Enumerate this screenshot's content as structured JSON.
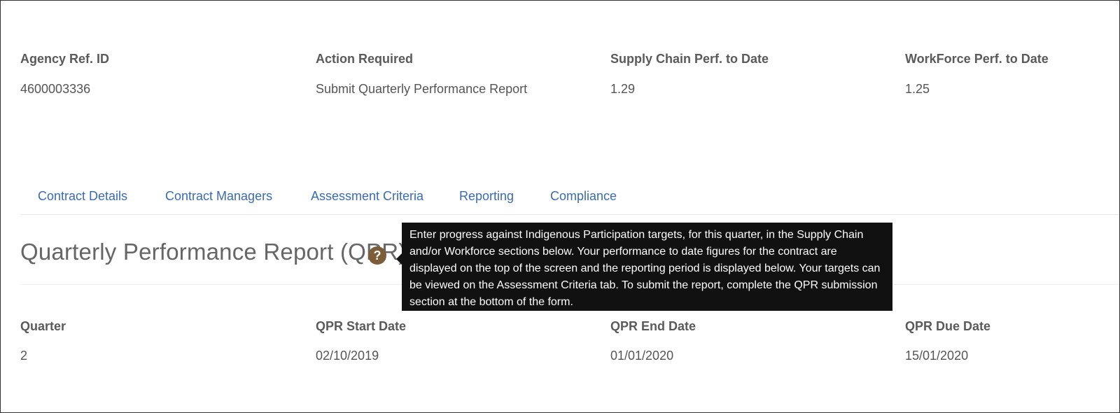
{
  "summary": {
    "agency_ref_id": {
      "label": "Agency Ref. ID",
      "value": "4600003336"
    },
    "action_required": {
      "label": "Action Required",
      "value": "Submit Quarterly Performance Report"
    },
    "supply_chain_perf": {
      "label": "Supply Chain Perf. to Date",
      "value": "1.29"
    },
    "workforce_perf": {
      "label": "WorkForce Perf. to Date",
      "value": "1.25"
    }
  },
  "tabs": [
    {
      "label": "Contract Details"
    },
    {
      "label": "Contract Managers"
    },
    {
      "label": "Assessment Criteria"
    },
    {
      "label": "Reporting"
    },
    {
      "label": "Compliance"
    }
  ],
  "section": {
    "title": "Quarterly Performance Report (QPR)",
    "help_icon": "question-circle-icon",
    "tooltip": "Enter progress against Indigenous Participation targets, for this quarter, in the Supply Chain and/or Workforce sections below. Your performance to date figures for the contract are displayed on the top of the screen and the reporting period is displayed below. Your targets can be viewed on the Assessment Criteria tab. To submit the report, complete the QPR submission section at the bottom of the form."
  },
  "period": {
    "quarter": {
      "label": "Quarter",
      "value": "2"
    },
    "start_date": {
      "label": "QPR Start Date",
      "value": "02/10/2019"
    },
    "end_date": {
      "label": "QPR End Date",
      "value": "01/01/2020"
    },
    "due_date": {
      "label": "QPR Due Date",
      "value": "15/01/2020"
    }
  },
  "colors": {
    "tab_link": "#3a6bb0",
    "help_icon": "#7d5c3a",
    "tooltip_bg": "#111111"
  }
}
